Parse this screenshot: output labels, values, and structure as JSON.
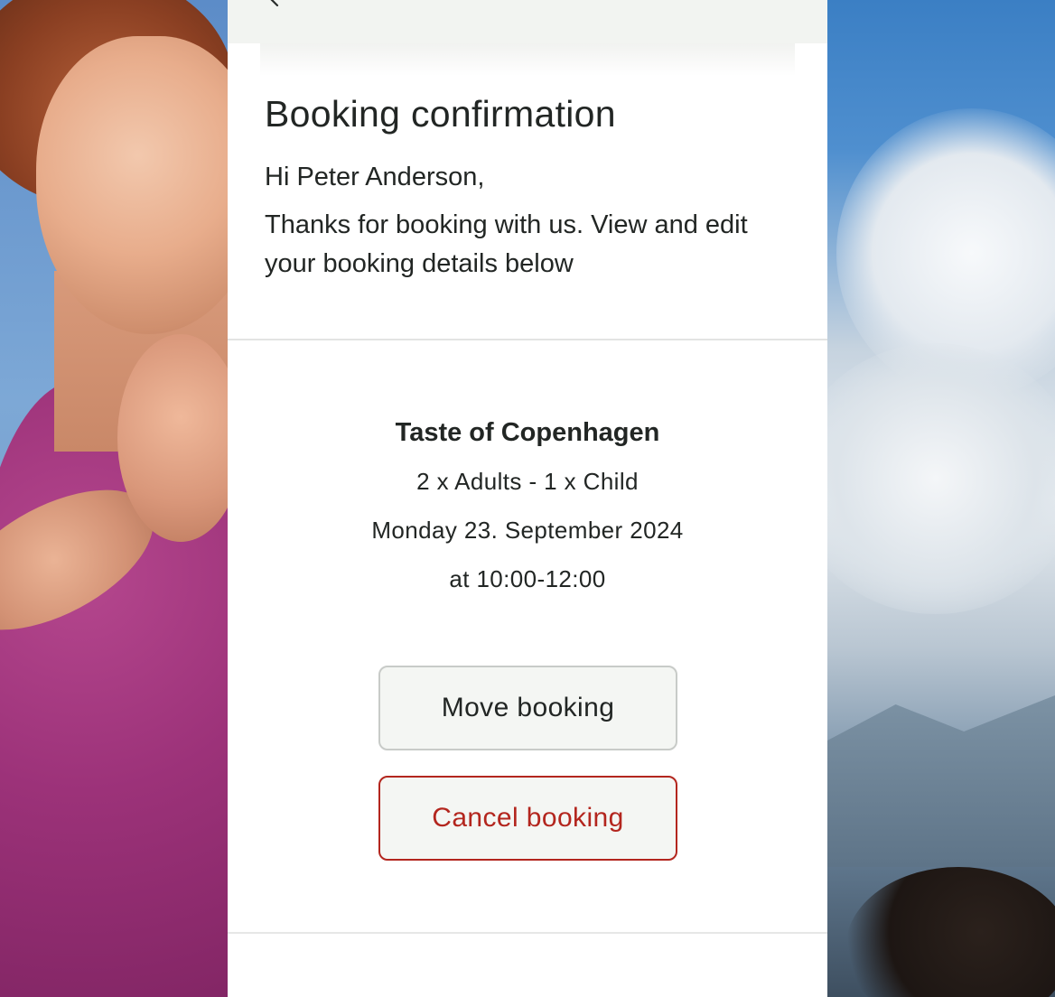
{
  "modal": {
    "title": "Booking confirmation",
    "greeting": "Hi Peter Anderson,",
    "intro": "Thanks for booking with us. View and edit your booking details below"
  },
  "booking": {
    "tour_name": "Taste of Copenhagen",
    "participants": "2 x Adults - 1 x Child",
    "date": "Monday 23. September 2024",
    "time": "at 10:00-12:00"
  },
  "actions": {
    "move_label": "Move booking",
    "cancel_label": "Cancel booking"
  },
  "icons": {
    "back": "chevron-left-icon"
  },
  "colors": {
    "cancel_accent": "#b3261e",
    "secondary_button_bg": "#f4f6f3",
    "topbar_bg": "#f2f4f1"
  }
}
